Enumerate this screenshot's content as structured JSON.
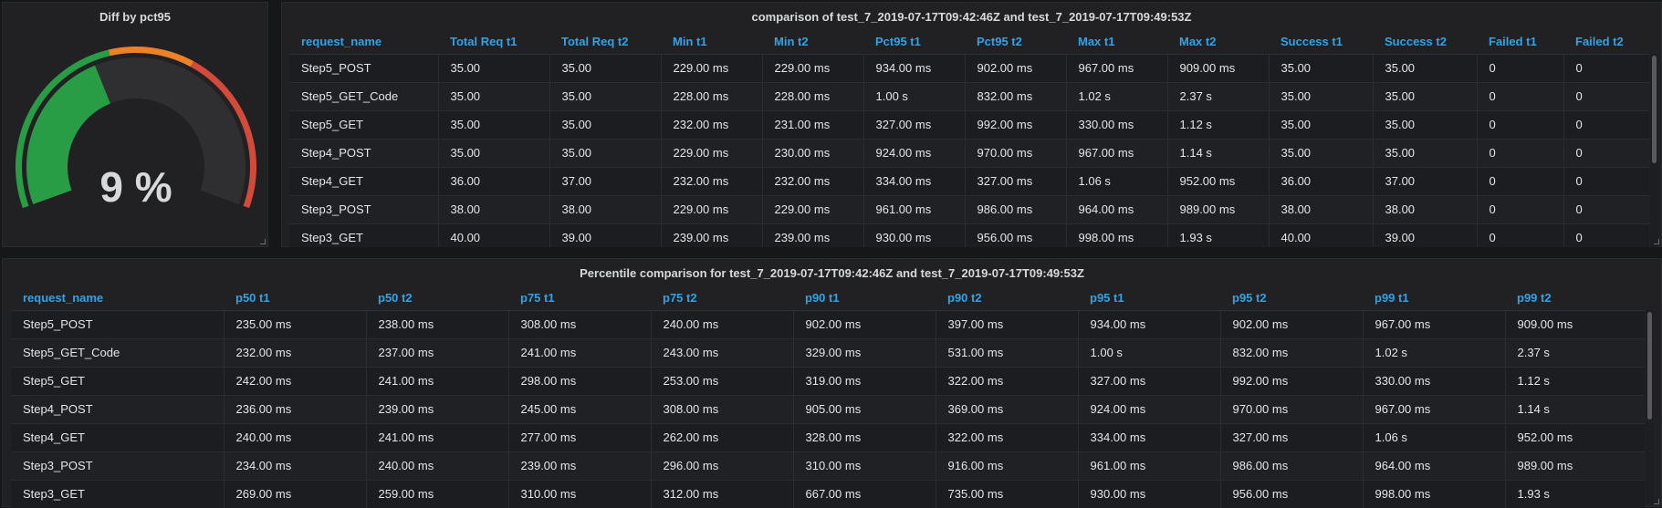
{
  "gauge": {
    "title": "Diff by pct95",
    "value": 9,
    "display": "9 %",
    "colors": {
      "green": "#299c46",
      "orange": "#ed8128",
      "red": "#d44a3a",
      "track": "#2f2f32"
    }
  },
  "comparison": {
    "title": "comparison of test_7_2019-07-17T09:42:46Z and test_7_2019-07-17T09:49:53Z",
    "columns": [
      "request_name",
      "Total Req t1",
      "Total Req t2",
      "Min t1",
      "Min t2",
      "Pct95 t1",
      "Pct95 t2",
      "Max t1",
      "Max t2",
      "Success t1",
      "Success t2",
      "Failed t1",
      "Failed t2"
    ],
    "rows": [
      [
        "Step5_POST",
        "35.00",
        "35.00",
        "229.00 ms",
        "229.00 ms",
        "934.00 ms",
        "902.00 ms",
        "967.00 ms",
        "909.00 ms",
        "35.00",
        "35.00",
        "0",
        "0"
      ],
      [
        "Step5_GET_Code",
        "35.00",
        "35.00",
        "228.00 ms",
        "228.00 ms",
        "1.00 s",
        "832.00 ms",
        "1.02 s",
        "2.37 s",
        "35.00",
        "35.00",
        "0",
        "0"
      ],
      [
        "Step5_GET",
        "35.00",
        "35.00",
        "232.00 ms",
        "231.00 ms",
        "327.00 ms",
        "992.00 ms",
        "330.00 ms",
        "1.12 s",
        "35.00",
        "35.00",
        "0",
        "0"
      ],
      [
        "Step4_POST",
        "35.00",
        "35.00",
        "229.00 ms",
        "230.00 ms",
        "924.00 ms",
        "970.00 ms",
        "967.00 ms",
        "1.14 s",
        "35.00",
        "35.00",
        "0",
        "0"
      ],
      [
        "Step4_GET",
        "36.00",
        "37.00",
        "232.00 ms",
        "232.00 ms",
        "334.00 ms",
        "327.00 ms",
        "1.06 s",
        "952.00 ms",
        "36.00",
        "37.00",
        "0",
        "0"
      ],
      [
        "Step3_POST",
        "38.00",
        "38.00",
        "229.00 ms",
        "229.00 ms",
        "961.00 ms",
        "986.00 ms",
        "964.00 ms",
        "989.00 ms",
        "38.00",
        "38.00",
        "0",
        "0"
      ],
      [
        "Step3_GET",
        "40.00",
        "39.00",
        "239.00 ms",
        "239.00 ms",
        "930.00 ms",
        "956.00 ms",
        "998.00 ms",
        "1.93 s",
        "40.00",
        "39.00",
        "0",
        "0"
      ]
    ]
  },
  "percentile": {
    "title": "Percentile comparison for test_7_2019-07-17T09:42:46Z and test_7_2019-07-17T09:49:53Z",
    "columns": [
      "request_name",
      "p50 t1",
      "p50 t2",
      "p75 t1",
      "p75 t2",
      "p90 t1",
      "p90 t2",
      "p95 t1",
      "p95 t2",
      "p99 t1",
      "p99 t2"
    ],
    "rows": [
      [
        "Step5_POST",
        "235.00 ms",
        "238.00 ms",
        "308.00 ms",
        "240.00 ms",
        "902.00 ms",
        "397.00 ms",
        "934.00 ms",
        "902.00 ms",
        "967.00 ms",
        "909.00 ms"
      ],
      [
        "Step5_GET_Code",
        "232.00 ms",
        "237.00 ms",
        "241.00 ms",
        "243.00 ms",
        "329.00 ms",
        "531.00 ms",
        "1.00 s",
        "832.00 ms",
        "1.02 s",
        "2.37 s"
      ],
      [
        "Step5_GET",
        "242.00 ms",
        "241.00 ms",
        "298.00 ms",
        "253.00 ms",
        "319.00 ms",
        "322.00 ms",
        "327.00 ms",
        "992.00 ms",
        "330.00 ms",
        "1.12 s"
      ],
      [
        "Step4_POST",
        "236.00 ms",
        "239.00 ms",
        "245.00 ms",
        "308.00 ms",
        "905.00 ms",
        "369.00 ms",
        "924.00 ms",
        "970.00 ms",
        "967.00 ms",
        "1.14 s"
      ],
      [
        "Step4_GET",
        "240.00 ms",
        "241.00 ms",
        "277.00 ms",
        "262.00 ms",
        "328.00 ms",
        "322.00 ms",
        "334.00 ms",
        "327.00 ms",
        "1.06 s",
        "952.00 ms"
      ],
      [
        "Step3_POST",
        "234.00 ms",
        "240.00 ms",
        "239.00 ms",
        "296.00 ms",
        "310.00 ms",
        "916.00 ms",
        "961.00 ms",
        "986.00 ms",
        "964.00 ms",
        "989.00 ms"
      ],
      [
        "Step3_GET",
        "269.00 ms",
        "259.00 ms",
        "310.00 ms",
        "312.00 ms",
        "667.00 ms",
        "735.00 ms",
        "930.00 ms",
        "956.00 ms",
        "998.00 ms",
        "1.93 s"
      ]
    ]
  }
}
